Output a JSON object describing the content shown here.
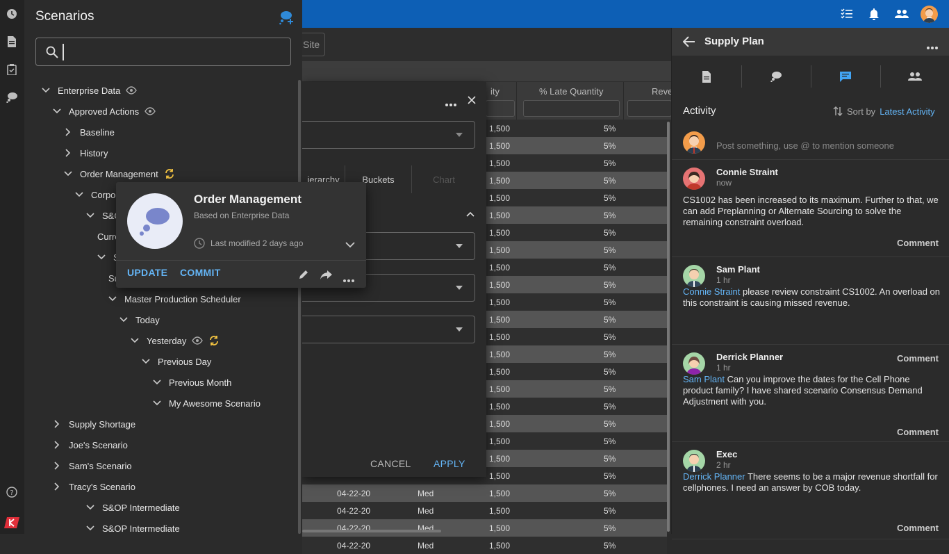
{
  "colors": {
    "topbar": "#0d5fb5",
    "accent": "#64b5f6",
    "sync": "#f5c542"
  },
  "main": {
    "site_label": "Site",
    "columns": [
      "ity",
      "% Late Quantity",
      "Reve"
    ],
    "row_values": {
      "qty": "1,500",
      "pct": "5%"
    },
    "bottom_rows": [
      {
        "date": "04-22-20",
        "pri": "Med",
        "qty": "1,500",
        "pct": "5%"
      },
      {
        "date": "04-22-20",
        "pri": "Med",
        "qty": "1,500",
        "pct": "5%"
      },
      {
        "date": "04-22-20",
        "pri": "Med",
        "qty": "1,500",
        "pct": "5%"
      },
      {
        "date": "04-22-20",
        "pri": "Med",
        "qty": "1,500",
        "pct": "5%"
      }
    ]
  },
  "dialog": {
    "tabs": [
      "ierarchy",
      "Buckets",
      "Chart"
    ],
    "cancel": "CANCEL",
    "apply": "APPLY"
  },
  "sidebar": {
    "title": "Scenarios",
    "search_value": "",
    "tree": [
      {
        "label": "Enterprise Data",
        "expanded": true,
        "eye": true
      },
      {
        "label": "Approved Actions",
        "expanded": true,
        "eye": true
      },
      {
        "label": "Baseline",
        "expanded": false
      },
      {
        "label": "History",
        "expanded": false
      },
      {
        "label": "Order Management",
        "expanded": true,
        "sync": true
      },
      {
        "label": "Corpora",
        "expanded": true
      },
      {
        "label": "S&OI",
        "expanded": true
      },
      {
        "label": "Curre"
      },
      {
        "label": "S&",
        "expanded": true
      },
      {
        "label": "Su"
      },
      {
        "label": "Master Production Scheduler",
        "expanded": true
      },
      {
        "label": "Today",
        "expanded": true
      },
      {
        "label": "Yesterday",
        "expanded": true,
        "eye": true,
        "sync": true
      },
      {
        "label": "Previous Day",
        "expanded": true
      },
      {
        "label": "Previous Month",
        "expanded": true
      },
      {
        "label": "My Awesome Scenario",
        "expanded": true
      },
      {
        "label": "Supply Shortage",
        "expanded": false
      },
      {
        "label": "Joe's Scenario",
        "expanded": false
      },
      {
        "label": "Sam's Scenario",
        "expanded": false
      },
      {
        "label": "Tracy's Scenario",
        "expanded": false
      },
      {
        "label": "S&OP Intermediate",
        "expanded": true
      },
      {
        "label": "S&OP Intermediate",
        "expanded": true
      }
    ]
  },
  "popover": {
    "title": "Order Management",
    "subtitle": "Based on Enterprise Data",
    "modified": "Last modified 2 days ago",
    "update": "UPDATE",
    "commit": "COMMIT"
  },
  "panel": {
    "title": "Supply Plan",
    "activity_title": "Activity",
    "sort_label": "Sort by",
    "sort_value": "Latest Activity",
    "post_placeholder": "Post something, use @ to mention someone",
    "comment_label": "Comment",
    "entries": [
      {
        "name": "Connie Straint",
        "time": "now",
        "mention": "",
        "body": "CS1002 has been increased to its maximum. Further to that, we can add Preplanning or Alternate Sourcing to solve the remaining constraint overload."
      },
      {
        "name": "Sam Plant",
        "time": "1 hr",
        "mention": "Connie Straint",
        "body": " please review constraint CS1002. An overload on this constraint is causing missed revenue."
      },
      {
        "name": "Derrick Planner",
        "time": "1 hr",
        "mention": "Sam Plant",
        "body": " Can you improve the dates for the Cell Phone product family? I have shared scenario Consensus Demand Adjustment with you."
      },
      {
        "name": "Exec",
        "time": "2 hr",
        "mention": "Derrick Planner",
        "body": " There seems to be a major revenue shortfall for cellphones. I need an answer by COB today."
      }
    ]
  }
}
